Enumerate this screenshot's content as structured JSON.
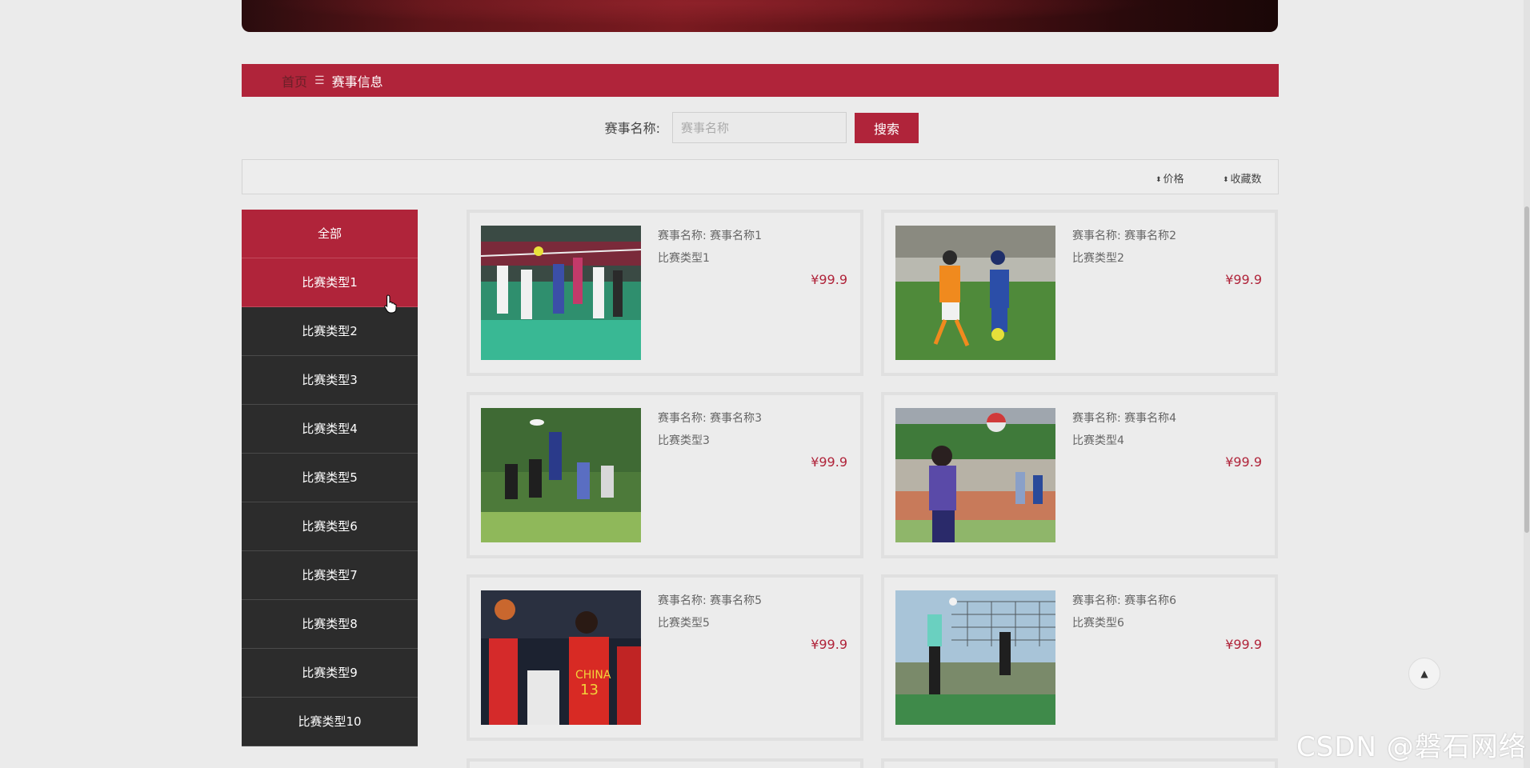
{
  "breadcrumb": {
    "home": "首页",
    "separator": "☰",
    "current": "赛事信息"
  },
  "search": {
    "label": "赛事名称:",
    "placeholder": "赛事名称",
    "value": "",
    "button": "搜索"
  },
  "sort": [
    {
      "label": "价格",
      "icon": "sort-updown-icon"
    },
    {
      "label": "收藏数",
      "icon": "sort-updown-icon"
    }
  ],
  "sidebar": {
    "items": [
      {
        "label": "全部",
        "active": true
      },
      {
        "label": "比赛类型1",
        "active": true
      },
      {
        "label": "比赛类型2",
        "active": false
      },
      {
        "label": "比赛类型3",
        "active": false
      },
      {
        "label": "比赛类型4",
        "active": false
      },
      {
        "label": "比赛类型5",
        "active": false
      },
      {
        "label": "比赛类型6",
        "active": false
      },
      {
        "label": "比赛类型7",
        "active": false
      },
      {
        "label": "比赛类型8",
        "active": false
      },
      {
        "label": "比赛类型9",
        "active": false
      },
      {
        "label": "比赛类型10",
        "active": false
      }
    ]
  },
  "cards": [
    {
      "name": "赛事名称:  赛事名称1",
      "type": "比赛类型1",
      "price": "¥99.9",
      "photo": "volleyball-indoor-photo"
    },
    {
      "name": "赛事名称:  赛事名称2",
      "type": "比赛类型2",
      "price": "¥99.9",
      "photo": "soccer-kids-photo"
    },
    {
      "name": "赛事名称:  赛事名称3",
      "type": "比赛类型3",
      "price": "¥99.9",
      "photo": "ultimate-frisbee-photo"
    },
    {
      "name": "赛事名称:  赛事名称4",
      "type": "比赛类型4",
      "price": "¥99.9",
      "photo": "volleyball-outdoor-photo"
    },
    {
      "name": "赛事名称:  赛事名称5",
      "type": "比赛类型5",
      "price": "¥99.9",
      "photo": "basketball-photo"
    },
    {
      "name": "赛事名称:  赛事名称6",
      "type": "比赛类型6",
      "price": "¥99.9",
      "photo": "volleyball-net-photo"
    }
  ],
  "back_to_top": "▲",
  "watermark": "CSDN @磐石网络",
  "colors": {
    "accent": "#b0243a",
    "sidebar_bg": "#2c2c2c",
    "page_bg": "#ebebeb"
  }
}
